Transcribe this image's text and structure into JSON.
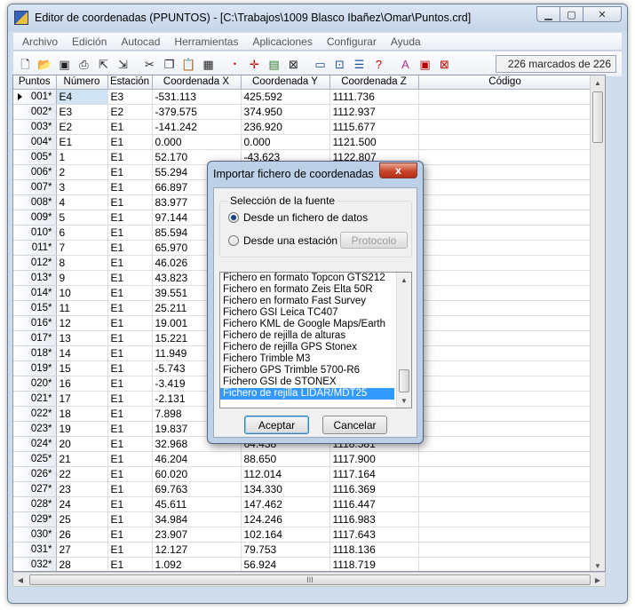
{
  "window": {
    "title": "Editor de coordenadas (PPUNTOS) - [C:\\Trabajos\\1009 Blasco Ibañez\\Omar\\Puntos.crd]",
    "minimize_label": "▁",
    "maximize_label": "▢",
    "close_label": "✕"
  },
  "menu": [
    "Archivo",
    "Edición",
    "Autocad",
    "Herramientas",
    "Aplicaciones",
    "Configurar",
    "Ayuda"
  ],
  "toolbar": {
    "icons": [
      "new-file-icon",
      "open-folder-icon",
      "save-icon",
      "print-icon",
      "export-icon",
      "import-icon",
      "cut-icon",
      "copy-icon",
      "paste-icon",
      "paste-special-icon",
      "point-icon",
      "cross-icon",
      "label-icon",
      "select-area-icon",
      "grid-view-icon",
      "zoom-view-icon",
      "layer-icon",
      "help-icon",
      "font-icon",
      "window-icon",
      "window-close-icon"
    ],
    "status": "226 marcados de 226"
  },
  "grid": {
    "columns": [
      "Puntos",
      "Número",
      "Estación",
      "Coordenada X",
      "Coordenada Y",
      "Coordenada Z",
      "Código"
    ],
    "rows": [
      [
        "001*",
        "E4",
        "E3",
        "-531.113",
        "425.592",
        "1111.736",
        ""
      ],
      [
        "002*",
        "E3",
        "E2",
        "-379.575",
        "374.950",
        "1112.937",
        ""
      ],
      [
        "003*",
        "E2",
        "E1",
        "-141.242",
        "236.920",
        "1115.677",
        ""
      ],
      [
        "004*",
        "E1",
        "E1",
        "0.000",
        "0.000",
        "1121.500",
        ""
      ],
      [
        "005*",
        "1",
        "E1",
        "52.170",
        "-43.623",
        "1122.807",
        ""
      ],
      [
        "006*",
        "2",
        "E1",
        "55.294",
        "",
        "",
        ""
      ],
      [
        "007*",
        "3",
        "E1",
        "66.897",
        "",
        "",
        ""
      ],
      [
        "008*",
        "4",
        "E1",
        "83.977",
        "",
        "",
        ""
      ],
      [
        "009*",
        "5",
        "E1",
        "97.144",
        "",
        "",
        ""
      ],
      [
        "010*",
        "6",
        "E1",
        "85.594",
        "",
        "",
        ""
      ],
      [
        "011*",
        "7",
        "E1",
        "65.970",
        "",
        "",
        ""
      ],
      [
        "012*",
        "8",
        "E1",
        "46.026",
        "",
        "",
        ""
      ],
      [
        "013*",
        "9",
        "E1",
        "43.823",
        "",
        "",
        ""
      ],
      [
        "014*",
        "10",
        "E1",
        "39.551",
        "",
        "",
        ""
      ],
      [
        "015*",
        "11",
        "E1",
        "25.211",
        "",
        "",
        ""
      ],
      [
        "016*",
        "12",
        "E1",
        "19.001",
        "",
        "",
        ""
      ],
      [
        "017*",
        "13",
        "E1",
        "15.221",
        "",
        "",
        ""
      ],
      [
        "018*",
        "14",
        "E1",
        "11.949",
        "",
        "",
        ""
      ],
      [
        "019*",
        "15",
        "E1",
        "-5.743",
        "",
        "",
        ""
      ],
      [
        "020*",
        "16",
        "E1",
        "-3.419",
        "",
        "",
        ""
      ],
      [
        "021*",
        "17",
        "E1",
        "-2.131",
        "",
        "",
        ""
      ],
      [
        "022*",
        "18",
        "E1",
        "7.898",
        "",
        "",
        ""
      ],
      [
        "023*",
        "19",
        "E1",
        "19.837",
        "",
        "",
        ""
      ],
      [
        "024*",
        "20",
        "E1",
        "32.968",
        "64.438",
        "1118.581",
        ""
      ],
      [
        "025*",
        "21",
        "E1",
        "46.204",
        "88.650",
        "1117.900",
        ""
      ],
      [
        "026*",
        "22",
        "E1",
        "60.020",
        "112.014",
        "1117.164",
        ""
      ],
      [
        "027*",
        "23",
        "E1",
        "69.763",
        "134.330",
        "1116.369",
        ""
      ],
      [
        "028*",
        "24",
        "E1",
        "45.611",
        "147.462",
        "1116.447",
        ""
      ],
      [
        "029*",
        "25",
        "E1",
        "34.984",
        "124.246",
        "1116.983",
        ""
      ],
      [
        "030*",
        "26",
        "E1",
        "23.907",
        "102.164",
        "1117.643",
        ""
      ],
      [
        "031*",
        "27",
        "E1",
        "12.127",
        "79.753",
        "1118.136",
        ""
      ],
      [
        "032*",
        "28",
        "E1",
        "1.092",
        "56.924",
        "1118.719",
        ""
      ]
    ]
  },
  "dialog": {
    "title": "Importar fichero de coordenadas",
    "close_label": "x",
    "group_title": "Selección de la fuente",
    "radio_file": "Desde un fichero de datos",
    "radio_station": "Desde una estación",
    "protocol_button": "Protocolo",
    "list": [
      "Fichero en formato Topcon GTS212",
      "Fichero en formato Zeis Elta 50R",
      "Fichero en formato Fast Survey",
      "Fichero GSI Leica TC407",
      "Fichero KML de Google Maps/Earth",
      "Fichero de rejilla de alturas",
      "Fichero de rejilla GPS Stonex",
      "Fichero Trimble M3",
      "Fichero GPS Trimble 5700-R6",
      "Fichero GSI de STONEX",
      "Fichero de rejilla LIDAR/MDT25"
    ],
    "selected_index": 10,
    "ok_button": "Aceptar",
    "cancel_button": "Cancelar"
  },
  "scroll": {
    "hscroll_grip": "III"
  }
}
